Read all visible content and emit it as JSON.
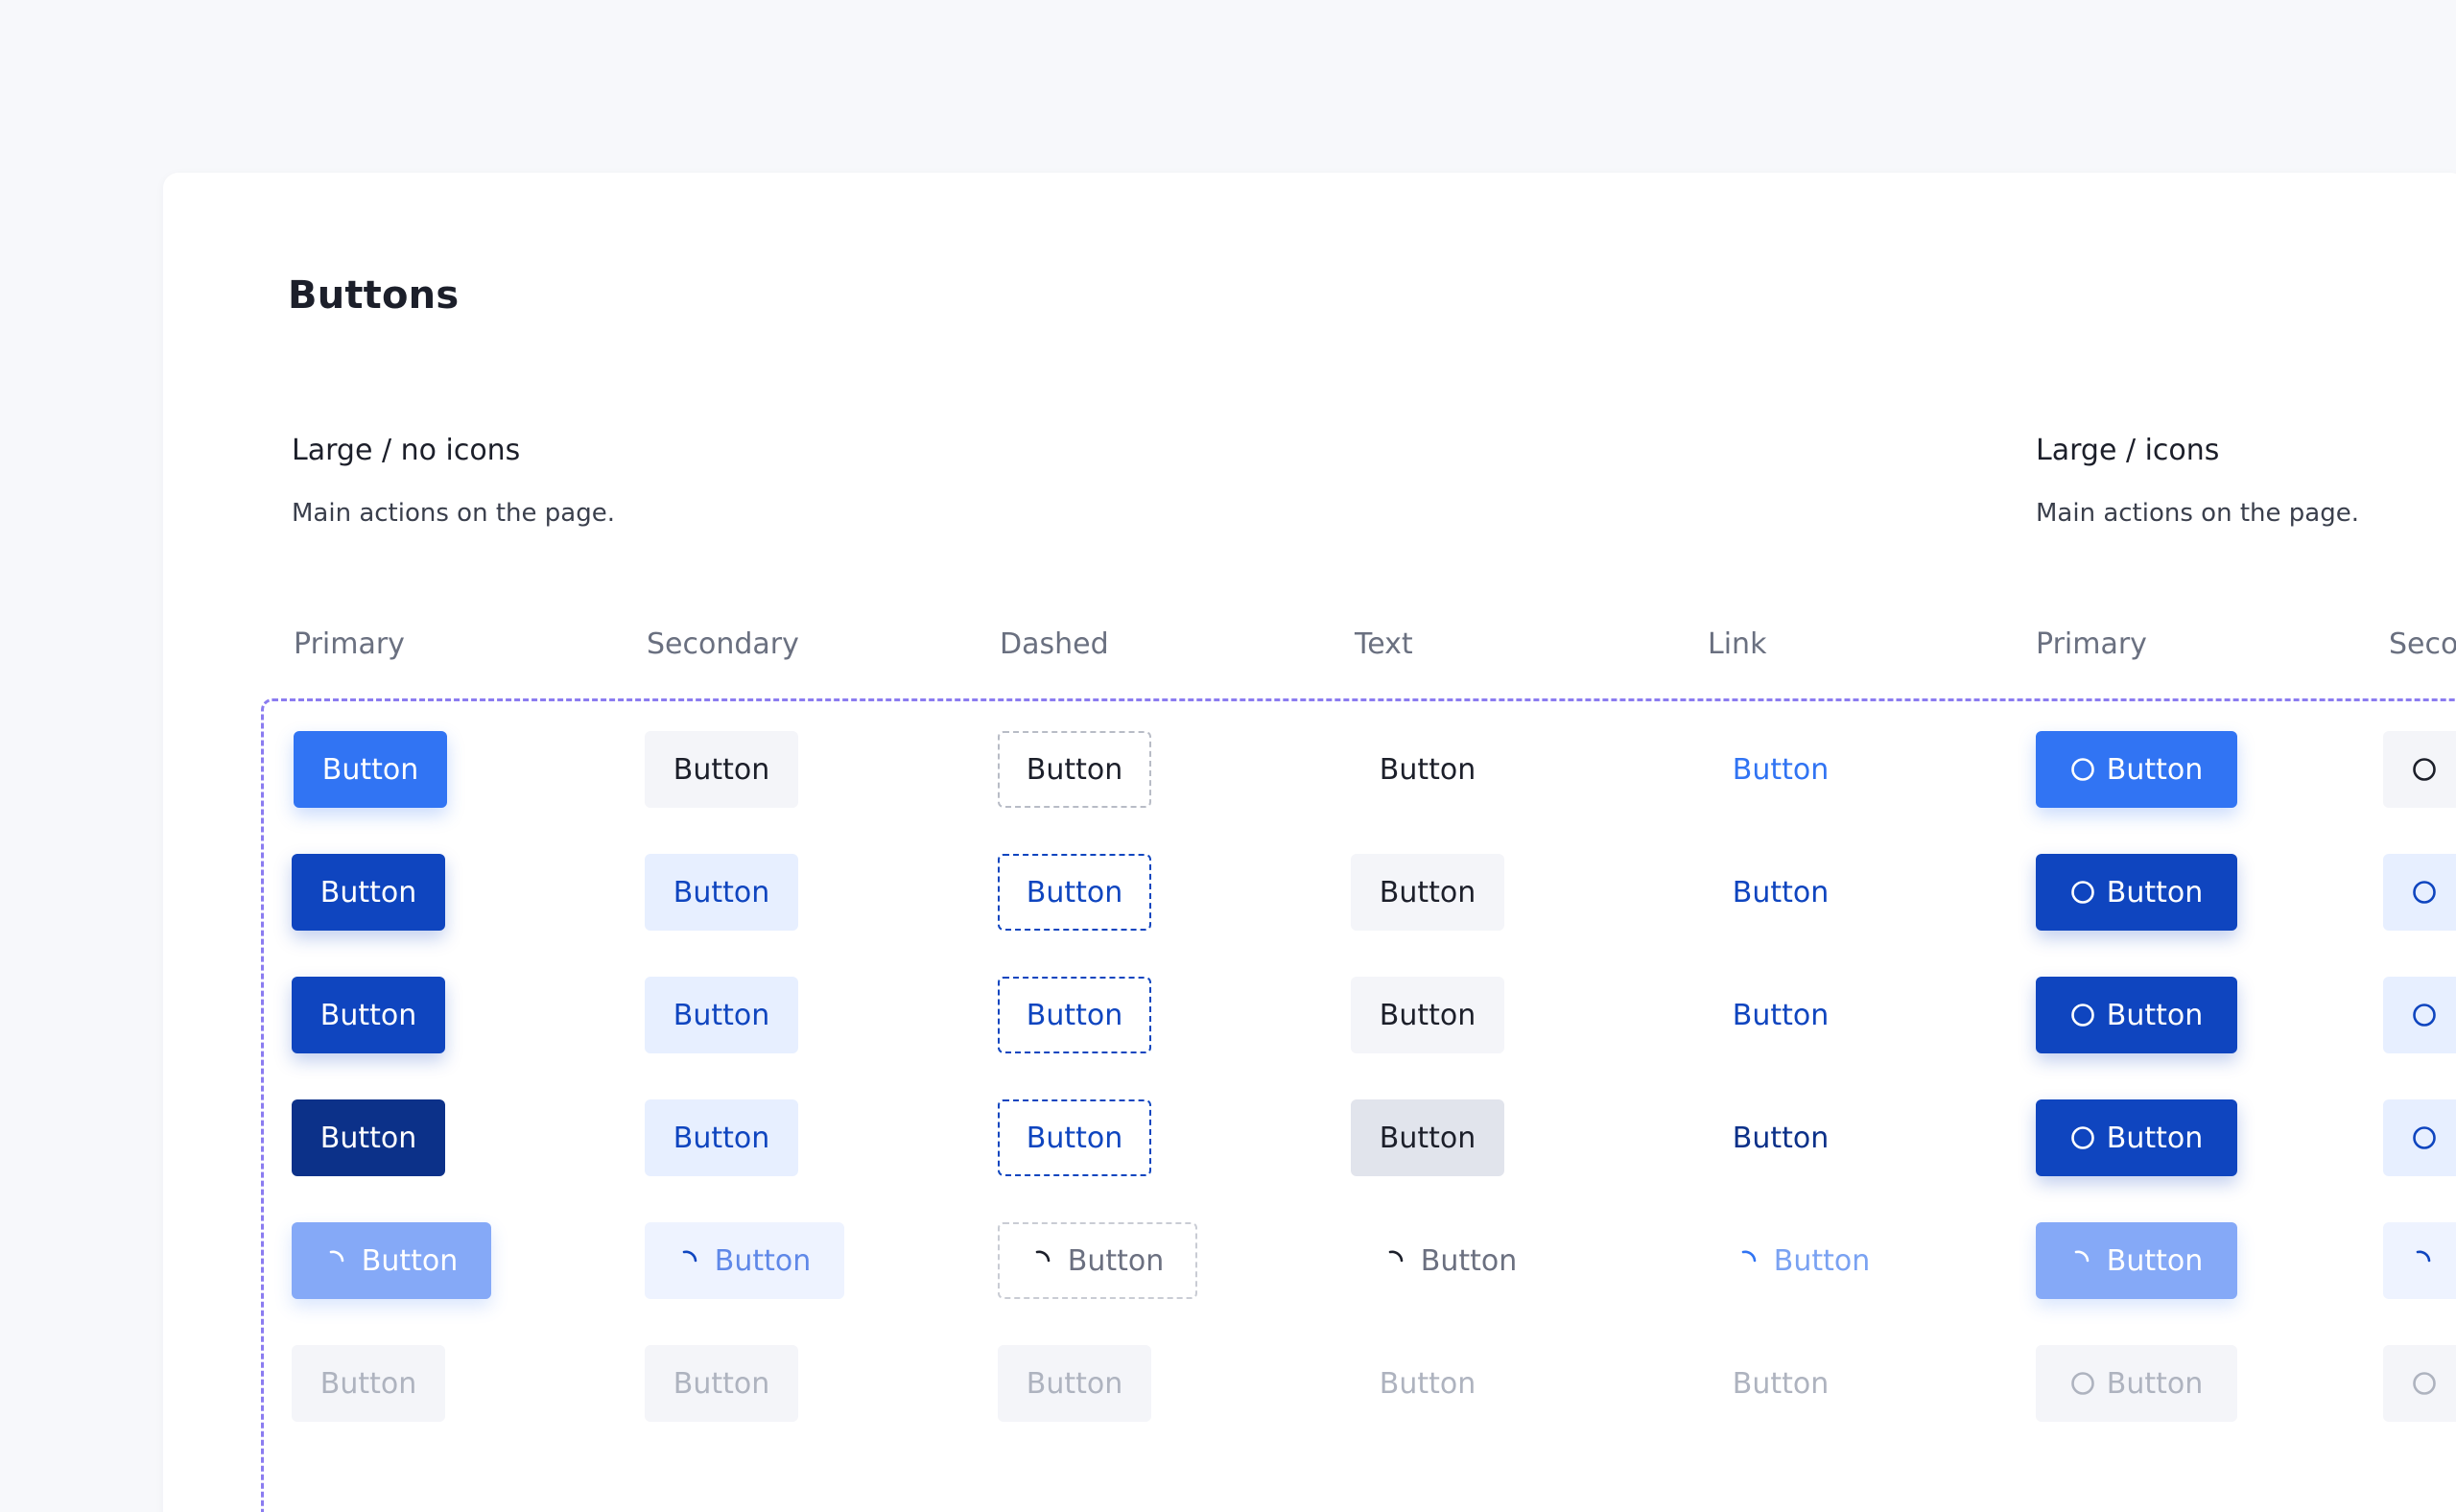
{
  "page": {
    "title": "Buttons"
  },
  "sections": [
    {
      "title": "Large / no icons",
      "description": "Main actions on the page."
    },
    {
      "title": "Large / icons",
      "description": "Main actions on the page."
    }
  ],
  "columns": [
    "Primary",
    "Secondary",
    "Dashed",
    "Text",
    "Link",
    "Primary",
    "Seco"
  ],
  "button_label": "Button",
  "colors": {
    "primary": "#3174f3",
    "primary_hover": "#0f45bf",
    "primary_pressed": "#0c3189",
    "primary_loading": "#85a9f7",
    "disabled_text": "#aeb3bf",
    "frame_dash": "#8b7cf0"
  },
  "icons": {
    "circle": "circle-icon",
    "spinner": "spinner-icon"
  },
  "states": [
    "default",
    "hover",
    "focus",
    "pressed",
    "loading",
    "disabled"
  ]
}
